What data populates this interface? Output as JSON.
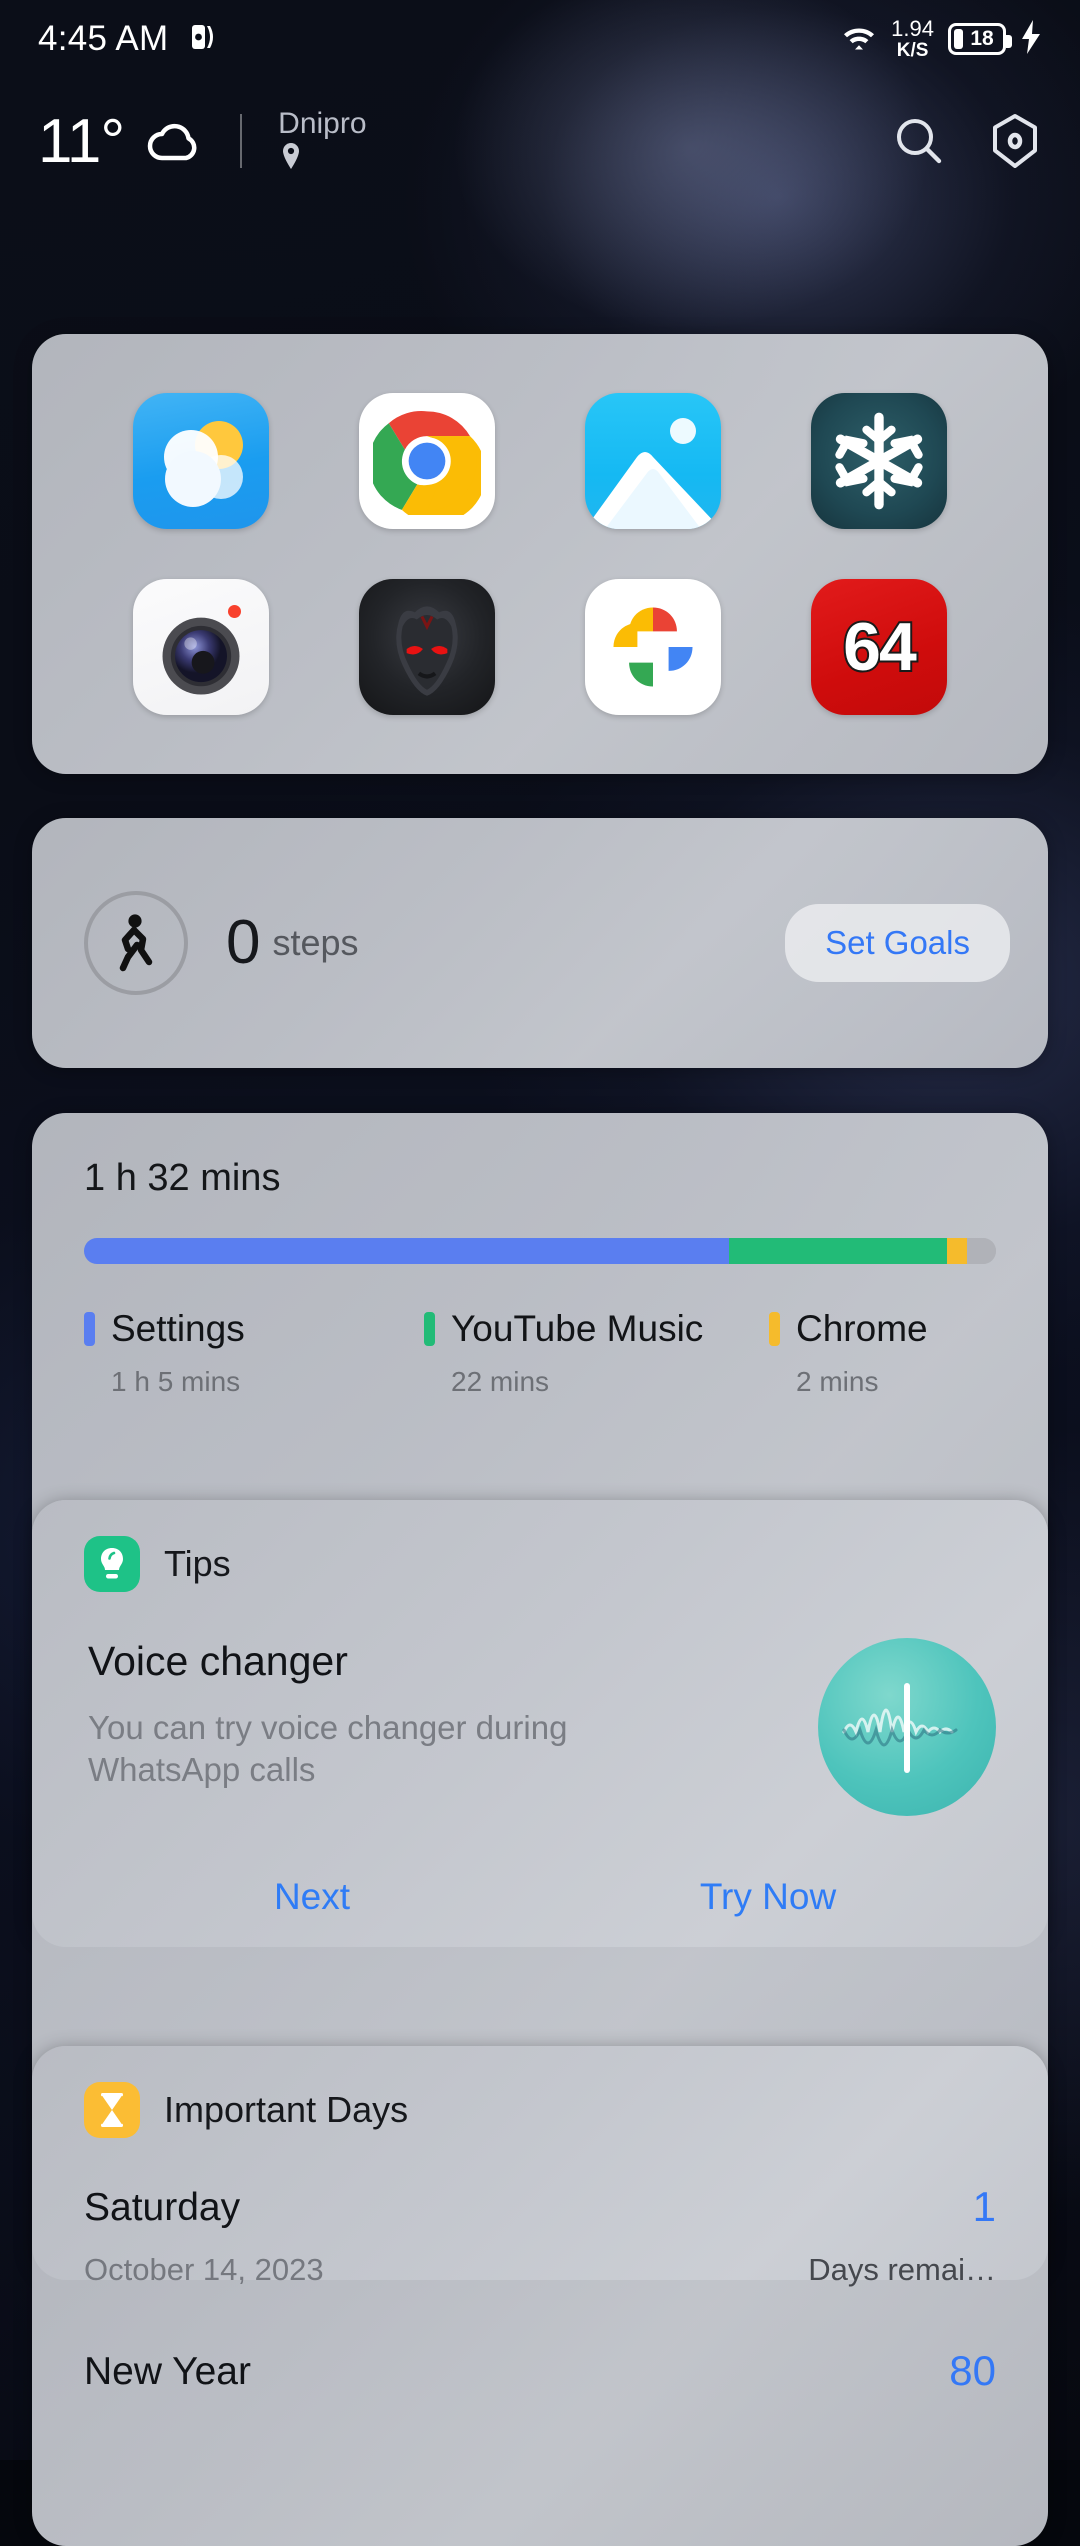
{
  "statusbar": {
    "time": "4:45 AM",
    "app_icon": "book-reader-icon",
    "wifi_icon": "wifi-icon",
    "net_speed_value": "1.94",
    "net_speed_unit": "K/S",
    "battery_level": "18",
    "charging_icon": "lightning-bolt-icon"
  },
  "header": {
    "temperature": "11°",
    "weather_icon": "cloud-icon",
    "location": "Dnipro",
    "location_pin_icon": "location-pin-icon",
    "search_icon": "search-icon",
    "settings_icon": "hexagon-dot-icon"
  },
  "apps": {
    "items": [
      {
        "name": "Weather",
        "icon": "weather-app-icon"
      },
      {
        "name": "Chrome",
        "icon": "chrome-app-icon"
      },
      {
        "name": "Gallery",
        "icon": "gallery-app-icon"
      },
      {
        "name": "Snowflake",
        "icon": "snowflake-app-icon"
      },
      {
        "name": "Camera",
        "icon": "camera-app-icon"
      },
      {
        "name": "Game",
        "icon": "dark-mask-game-icon"
      },
      {
        "name": "Google Photos",
        "icon": "google-photos-app-icon"
      },
      {
        "name": "64",
        "icon": "sixty-four-app-icon",
        "label": "64"
      }
    ]
  },
  "steps": {
    "walk_icon": "walking-person-icon",
    "count": "0",
    "unit": "steps",
    "set_goals_label": "Set Goals",
    "accent": "#3478f6"
  },
  "usage": {
    "total": "1 h 32 mins",
    "chart_data": {
      "type": "bar",
      "title": "1 h 32 mins",
      "categories": [
        "Settings",
        "YouTube Music",
        "Chrome",
        "Other"
      ],
      "values": [
        65,
        22,
        2,
        3
      ],
      "labels": [
        "1 h  5 mins",
        "22 mins",
        "2 mins",
        ""
      ],
      "colors": [
        "#5a7ef0",
        "#22bb77",
        "#f5bb2c",
        "#b0b2b8"
      ],
      "ylabel": "minutes",
      "xlabel": "",
      "legend_position": "bottom",
      "grid": false,
      "total_minutes": 92
    },
    "legend": [
      {
        "name": "Settings",
        "time": "1 h  5 mins",
        "color": "#5a7ef0",
        "width_pct": 70.7
      },
      {
        "name": "YouTube Music",
        "time": "22 mins",
        "color": "#22bb77",
        "width_pct": 23.9
      },
      {
        "name": "Chrome",
        "time": "2 mins",
        "color": "#f5bb2c",
        "width_pct": 2.2
      },
      {
        "name": "Other",
        "time": "",
        "color": "#b0b2b8",
        "width_pct": 3.2
      }
    ]
  },
  "tips": {
    "badge_icon": "lightbulb-icon",
    "title": "Tips",
    "item_title": "Voice changer",
    "item_desc": "You can try voice changer during WhatsApp calls",
    "art_icon": "voice-waveform-icon",
    "next_label": "Next",
    "try_now_label": "Try Now"
  },
  "important_days": {
    "badge_icon": "hourglass-icon",
    "title": "Important Days",
    "rows": [
      {
        "name": "Saturday",
        "date": "October 14, 2023",
        "count": "1",
        "remaining": "Days remai…"
      },
      {
        "name": "New Year",
        "date": "",
        "count": "80",
        "remaining": ""
      }
    ]
  }
}
